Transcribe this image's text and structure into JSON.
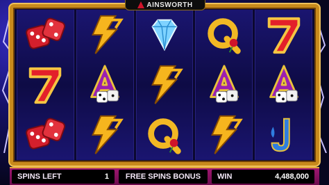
{
  "brand": {
    "logo_text": "AINSWORTH"
  },
  "reels": [
    [
      "red-dice",
      "red-seven",
      "red-dice"
    ],
    [
      "lightning-bolt",
      "purple-a-dice",
      "lightning-bolt"
    ],
    [
      "diamond",
      "lightning-bolt",
      "gold-q-rose"
    ],
    [
      "gold-q-rose",
      "purple-a-dice",
      "lightning-bolt"
    ],
    [
      "red-seven",
      "purple-a-dice",
      "blue-j-fleur"
    ]
  ],
  "status_bar": {
    "spins_left_label": "SPINS LEFT",
    "spins_left_value": "1",
    "bonus_label": "FREE SPINS BONUS",
    "win_label": "WIN",
    "win_value": "4,488,000"
  },
  "colors": {
    "frame_gold": "#c88a1c",
    "bar_magenta": "#a01670",
    "background_blue": "#151067"
  }
}
